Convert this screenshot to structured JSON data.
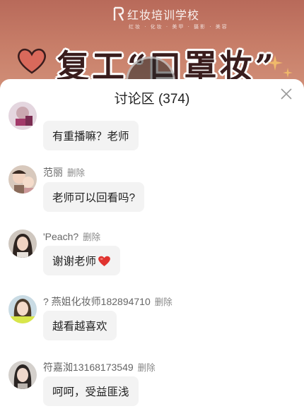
{
  "banner": {
    "logo_text": "红妆培训学校",
    "logo_sub": "红妆 · 化妆 · 美甲 · 摄影 · 美容",
    "title": "复工“口罩妆”",
    "colors": {
      "bg": "#c77d68",
      "title": "#3a1d1d"
    }
  },
  "panel": {
    "title": "讨论区 (374)",
    "close_icon": "close-icon"
  },
  "comments": [
    {
      "user": "",
      "delete_label": "",
      "text": "有重播嘛？老师",
      "avatar": "avatar-partial"
    },
    {
      "user": "范丽",
      "delete_label": "删除",
      "text": "老师可以回看吗?",
      "avatar": "avatar-child-photo"
    },
    {
      "user": "'Peach?",
      "delete_label": "删除",
      "text": "谢谢老师",
      "emoji": "red-heart-icon",
      "avatar": "avatar-woman-photo"
    },
    {
      "user": "? 燕姐化妆师182894710",
      "delete_label": "删除",
      "text": "越看越喜欢",
      "avatar": "avatar-woman-photo"
    },
    {
      "user": "符嘉洳13168173549",
      "delete_label": "删除",
      "text": "呵呵，受益匪浅",
      "avatar": "avatar-woman-photo"
    }
  ]
}
